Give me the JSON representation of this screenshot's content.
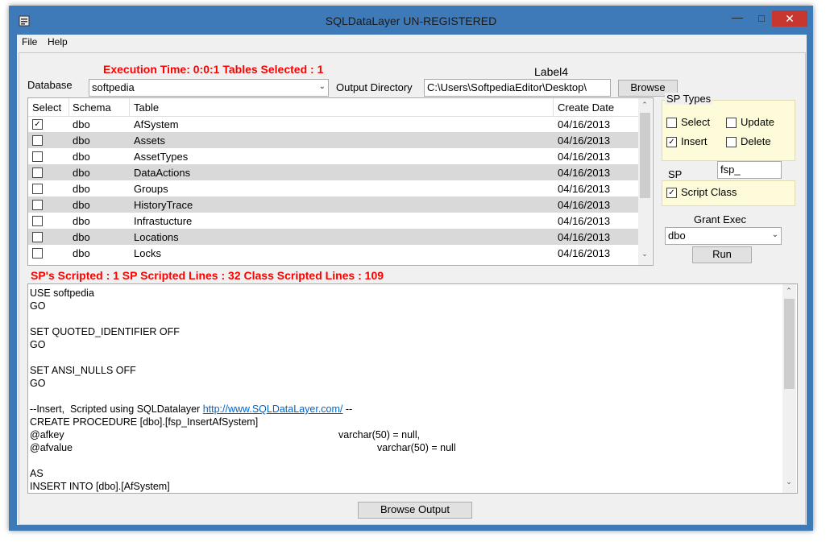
{
  "window": {
    "title": "SQLDataLayer UN-REGISTERED"
  },
  "menu": [
    "File",
    "Help"
  ],
  "header": {
    "execution": "Execution Time: 0:0:1 Tables Selected : 1",
    "label4": "Label4",
    "database_label": "Database",
    "database_value": "softpedia",
    "output_dir_label": "Output Directory",
    "output_dir_value": "C:\\Users\\SoftpediaEditor\\Desktop\\",
    "browse": "Browse"
  },
  "grid": {
    "columns": [
      "Select",
      "Schema",
      "Table",
      "Create Date"
    ],
    "rows": [
      {
        "checked": true,
        "schema": "dbo",
        "table": "AfSystem",
        "date": "04/16/2013"
      },
      {
        "checked": false,
        "schema": "dbo",
        "table": "Assets",
        "date": "04/16/2013"
      },
      {
        "checked": false,
        "schema": "dbo",
        "table": "AssetTypes",
        "date": "04/16/2013"
      },
      {
        "checked": false,
        "schema": "dbo",
        "table": "DataActions",
        "date": "04/16/2013"
      },
      {
        "checked": false,
        "schema": "dbo",
        "table": "Groups",
        "date": "04/16/2013"
      },
      {
        "checked": false,
        "schema": "dbo",
        "table": "HistoryTrace",
        "date": "04/16/2013"
      },
      {
        "checked": false,
        "schema": "dbo",
        "table": "Infrastucture",
        "date": "04/16/2013"
      },
      {
        "checked": false,
        "schema": "dbo",
        "table": "Locations",
        "date": "04/16/2013"
      },
      {
        "checked": false,
        "schema": "dbo",
        "table": "Locks",
        "date": "04/16/2013"
      }
    ]
  },
  "sp_types": {
    "title": "SP Types",
    "select": "Select",
    "update": "Update",
    "insert": "Insert",
    "delete": "Delete",
    "select_checked": false,
    "update_checked": false,
    "insert_checked": true,
    "delete_checked": false
  },
  "sp": {
    "label": "SP",
    "prefix": "fsp_"
  },
  "script_class": {
    "label": "Script Class",
    "checked": true
  },
  "grant": {
    "label": "Grant Exec",
    "value": "dbo"
  },
  "run": "Run",
  "scripted": "SP's Scripted : 1 SP Scripted Lines : 32 Class Scripted Lines : 109",
  "code": {
    "l1": "USE softpedia",
    "l2": "GO",
    "l3": "SET QUOTED_IDENTIFIER OFF",
    "l4": "GO",
    "l5": "SET ANSI_NULLS OFF",
    "l6": "GO",
    "l7_prefix": "--Insert,  Scripted using SQLDatalayer ",
    "l7_link": "http://www.SQLDataLayer.com/",
    "l7_suffix": " --",
    "l8": "CREATE PROCEDURE [dbo].[fsp_InsertAfSystem]",
    "l9_name": "@afkey",
    "l9_type": "varchar(50) = null,",
    "l10_name": "@afvalue",
    "l10_type": "varchar(50) = null",
    "l11": "AS",
    "l12": "INSERT INTO [dbo].[AfSystem]"
  },
  "browse_output": "Browse Output"
}
